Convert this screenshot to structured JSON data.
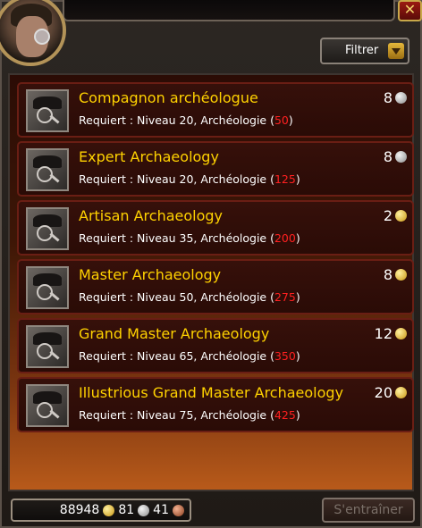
{
  "window": {
    "close_symbol": "✕"
  },
  "filter": {
    "label": "Filtrer"
  },
  "skills": [
    {
      "name": "Compagnon archéologue",
      "req_prefix": "Requiert : Niveau 20, Archéologie (",
      "rank": "50",
      "req_suffix": ")",
      "cost": "8",
      "coin": "silver"
    },
    {
      "name": "Expert Archaeology",
      "req_prefix": "Requiert : Niveau 20, Archéologie (",
      "rank": "125",
      "req_suffix": ")",
      "cost": "8",
      "coin": "silver"
    },
    {
      "name": "Artisan Archaeology",
      "req_prefix": "Requiert : Niveau 35, Archéologie (",
      "rank": "200",
      "req_suffix": ")",
      "cost": "2",
      "coin": "gold"
    },
    {
      "name": "Master Archaeology",
      "req_prefix": "Requiert : Niveau 50, Archéologie (",
      "rank": "275",
      "req_suffix": ")",
      "cost": "8",
      "coin": "gold"
    },
    {
      "name": "Grand Master Archaeology",
      "req_prefix": "Requiert : Niveau 65, Archéologie (",
      "rank": "350",
      "req_suffix": ")",
      "cost": "12",
      "coin": "gold"
    },
    {
      "name": "Illustrious Grand Master Archaeology",
      "req_prefix": "Requiert : Niveau 75, Archéologie (",
      "rank": "425",
      "req_suffix": ")",
      "cost": "20",
      "coin": "gold"
    }
  ],
  "money": {
    "gold": "88948",
    "silver": "81",
    "copper": "41"
  },
  "train_button": {
    "label": "S'entraîner"
  },
  "colors": {
    "name": "#ffd200",
    "rank": "#ff2020"
  }
}
